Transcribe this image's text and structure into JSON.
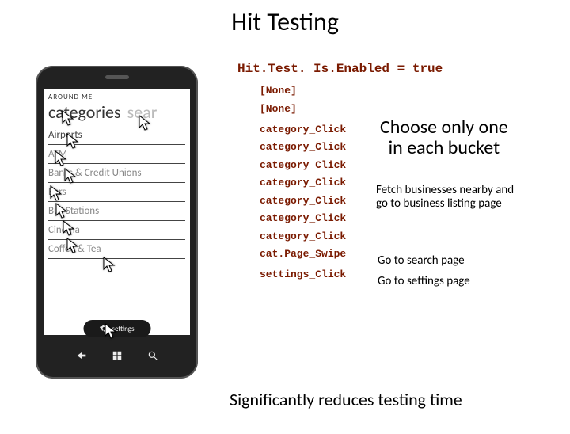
{
  "title": "Hit Testing",
  "code": "Hit.Test. Is.Enabled = true",
  "phone": {
    "app_title": "AROUND ME",
    "tabs": [
      "categories",
      "sear"
    ],
    "items": [
      "Airports",
      "ATM",
      "Banks & Credit Unions",
      "Bars",
      "Bus Stations",
      "Cinema",
      "Coffee & Tea"
    ],
    "settings": "settings"
  },
  "actions": [
    "[None]",
    "[None]",
    "category_Click",
    "category_Click",
    "category_Click",
    "category_Click",
    "category_Click",
    "category_Click",
    "category_Click",
    "cat.Page_Swipe",
    "settings_Click"
  ],
  "annotations": {
    "bucket1": "Choose only one",
    "bucket2": "in each bucket",
    "fetch1": "Fetch businesses nearby and",
    "fetch2": "go to business listing page",
    "search": "Go to search page",
    "settings": "Go to settings page"
  },
  "footer": "Significantly reduces testing time"
}
